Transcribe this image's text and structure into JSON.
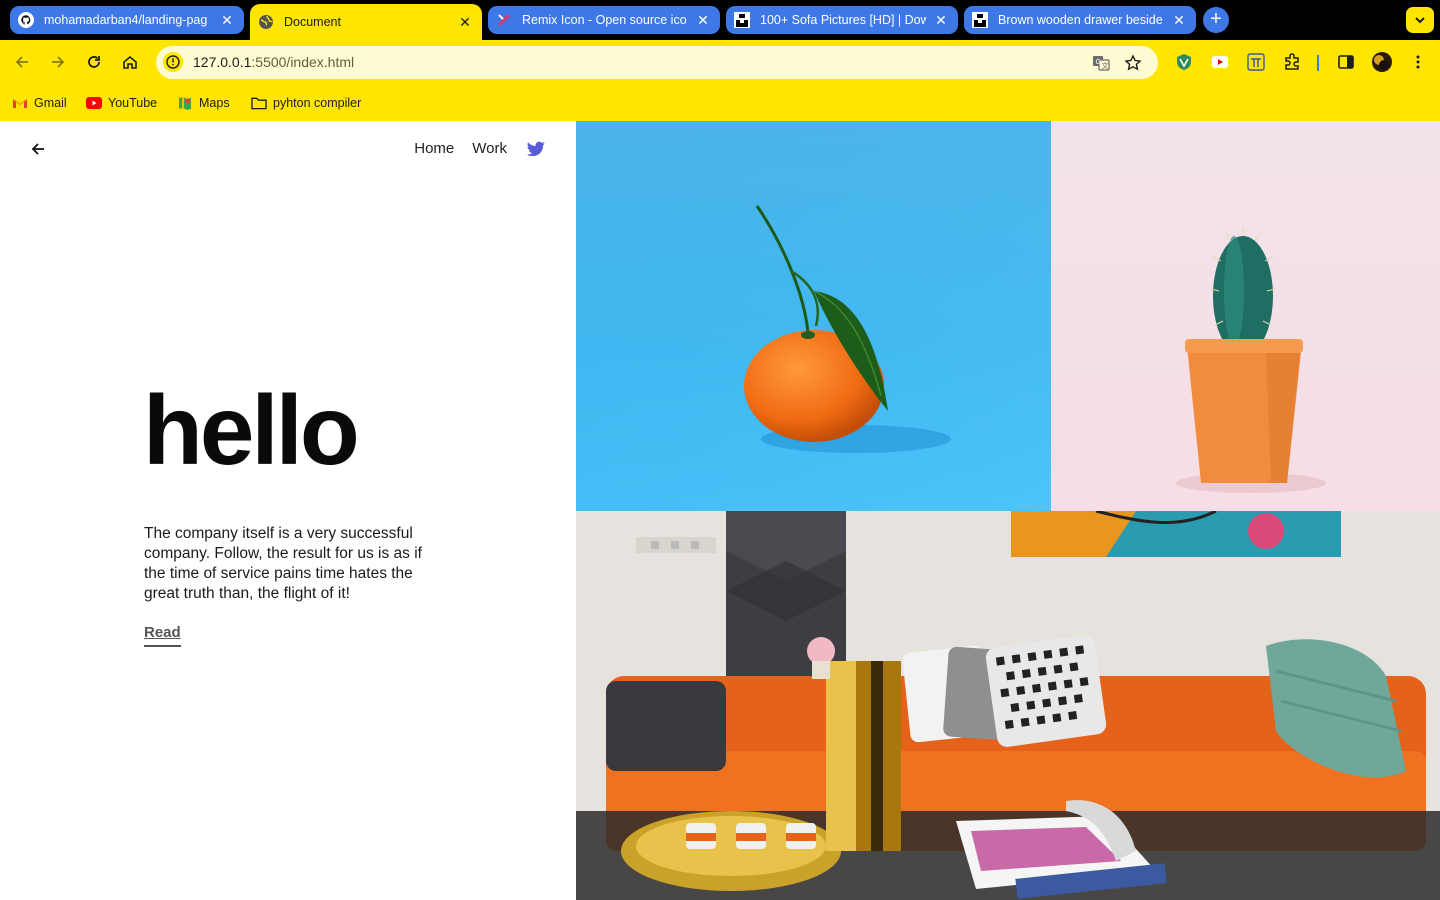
{
  "browser": {
    "tabs": [
      {
        "title": "mohamadarban4/landing-pag",
        "favicon": "github-icon",
        "active": false
      },
      {
        "title": "Document",
        "favicon": "globe-icon",
        "active": true
      },
      {
        "title": "Remix Icon - Open source ico",
        "favicon": "remix-icon",
        "active": false
      },
      {
        "title": "100+ Sofa Pictures [HD] | Dow",
        "favicon": "unsplash-icon",
        "active": false
      },
      {
        "title": "Brown wooden drawer beside",
        "favicon": "unsplash-icon",
        "active": false
      }
    ],
    "close_glyph": "✕",
    "new_tab_glyph": "+",
    "url_host": "127.0.0.1",
    "url_path": ":5500/index.html",
    "bookmarks": [
      {
        "label": "Gmail",
        "icon": "gmail-icon"
      },
      {
        "label": "YouTube",
        "icon": "youtube-icon"
      },
      {
        "label": "Maps",
        "icon": "maps-icon"
      },
      {
        "label": "pyhton compiler",
        "icon": "folder-icon"
      }
    ],
    "colors": {
      "theme": "#ffe600",
      "tab": "#3d78e6",
      "tabstrip": "#000000"
    }
  },
  "site": {
    "nav": {
      "home": "Home",
      "work": "Work",
      "twitter_icon": "twitter-icon"
    },
    "headline": "hello",
    "description": "The company itself is a very successful company. Follow, the result for us is as if the time of service pains time hates the great truth than, the flight of it!",
    "read_link": "Read",
    "images": [
      {
        "subject": "orange-on-blue",
        "background": "#3fb7f0"
      },
      {
        "subject": "cactus-in-orange-pot",
        "background": "#f4e0e8"
      },
      {
        "subject": "orange-sofa-living-room",
        "background": "#e9e6e3"
      }
    ]
  }
}
